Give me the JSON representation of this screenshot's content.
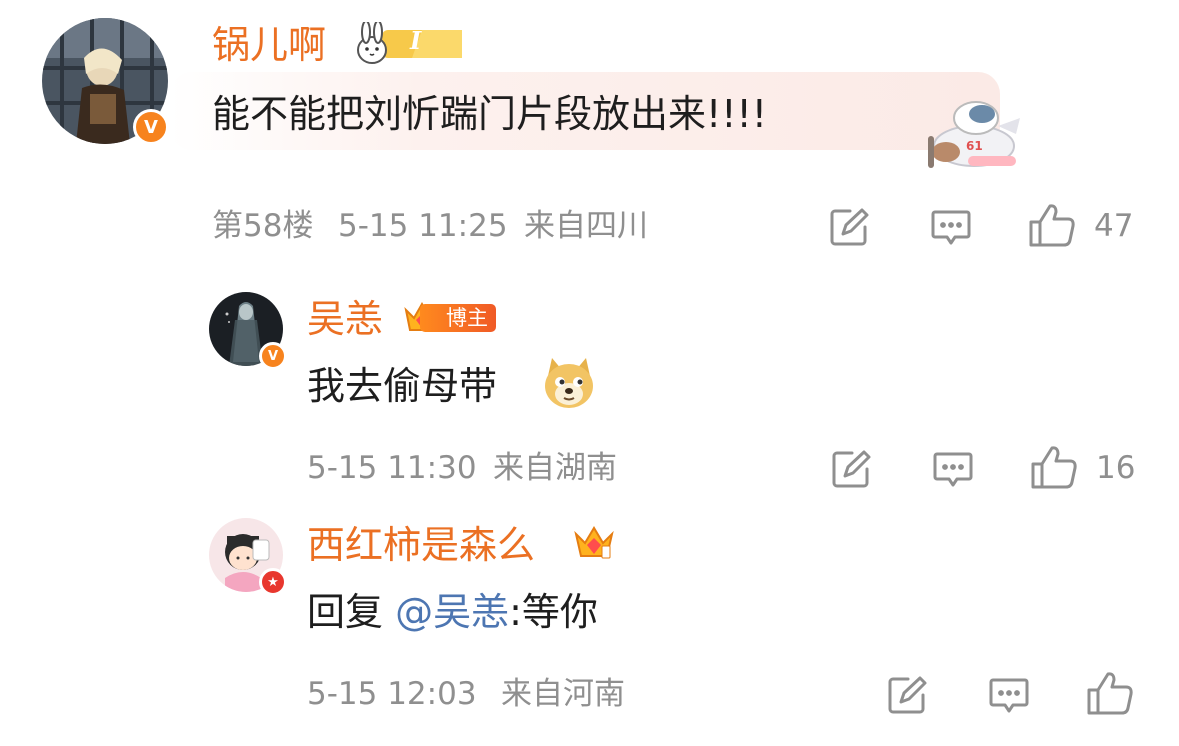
{
  "comment": {
    "username": "锅儿啊",
    "level_badge": "I",
    "text": "能不能把刘忻踹门片段放出来!!!!",
    "floor": "第58楼",
    "time": "5-15 11:25",
    "location": "来自四川",
    "like_count": "47",
    "verified_badge": "V"
  },
  "replies": [
    {
      "username": "吴恙",
      "role_tag": "博主",
      "text": "我去偷母带",
      "time": "5-15 11:30",
      "location": "来自湖南",
      "like_count": "16",
      "verified_badge": "V"
    },
    {
      "username": "西红柿是森么",
      "text_prefix": "回复 ",
      "mention": "@吴恙",
      "text_suffix": ":等你",
      "time": "5-15 12:03",
      "location": "来自河南",
      "like_count": "",
      "verified_badge": "★"
    }
  ],
  "icons": [
    "repost-icon",
    "comment-icon",
    "like-icon",
    "crown-icon",
    "rabbit-badge-icon",
    "doge-emoji",
    "plane-sticker"
  ],
  "colors": {
    "username": "#eb7023",
    "meta": "#8f8f8f",
    "mention": "#4d76b2",
    "badge": "#f7831e"
  }
}
